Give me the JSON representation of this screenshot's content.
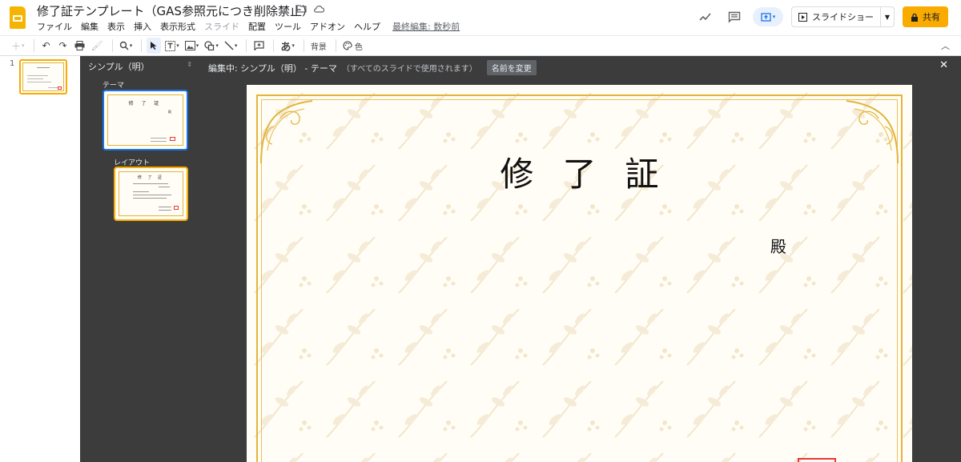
{
  "header": {
    "doc_title": "修了証テンプレート（GAS参照元につき削除禁止）",
    "menus": [
      {
        "label": "ファイル",
        "disabled": false
      },
      {
        "label": "編集",
        "disabled": false
      },
      {
        "label": "表示",
        "disabled": false
      },
      {
        "label": "挿入",
        "disabled": false
      },
      {
        "label": "表示形式",
        "disabled": false
      },
      {
        "label": "スライド",
        "disabled": true
      },
      {
        "label": "配置",
        "disabled": false
      },
      {
        "label": "ツール",
        "disabled": false
      },
      {
        "label": "アドオン",
        "disabled": false
      },
      {
        "label": "ヘルプ",
        "disabled": false
      }
    ],
    "last_edit": "最終編集: 数秒前",
    "slideshow_label": "スライドショー",
    "share_label": "共有"
  },
  "toolbar": {
    "input_tools_label": "あ",
    "background_label": "背景",
    "color_label": "色"
  },
  "filmstrip": {
    "slides": [
      {
        "number": "1"
      }
    ]
  },
  "theme_panel": {
    "title": "シンプル（明）",
    "theme_label": "テーマ",
    "layout_label": "レイアウト",
    "mini_title": "修 了 証",
    "mini_tono": "殿"
  },
  "editor": {
    "editing_label": "編集中: シンプル（明） - テーマ",
    "editing_sub": "（すべてのスライドで使用されます）",
    "rename_label": "名前を変更",
    "certificate_title": "修了証",
    "tono": "殿"
  },
  "colors": {
    "accent_gold": "#e2b53c",
    "share_yellow": "#f9ab00",
    "selection_blue": "#1a73e8",
    "panel_dark": "#3c3c3c",
    "seal_red": "#e53935"
  }
}
